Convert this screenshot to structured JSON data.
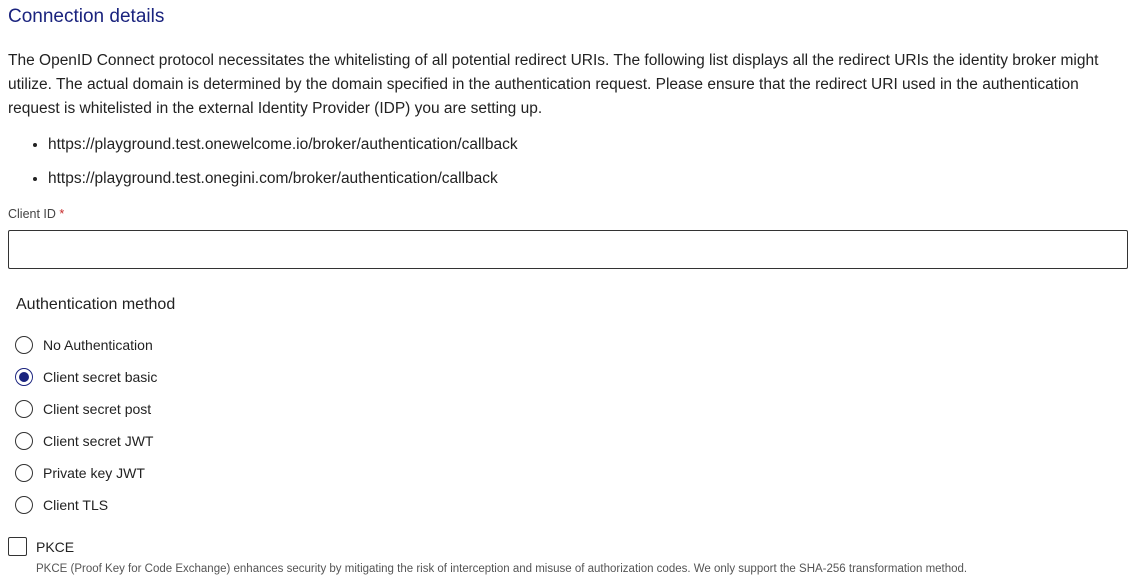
{
  "section": {
    "title": "Connection details",
    "description": "The OpenID Connect protocol necessitates the whitelisting of all potential redirect URIs. The following list displays all the redirect URIs the identity broker might utilize. The actual domain is determined by the domain specified in the authentication request. Please ensure that the redirect URI used in the authentication request is whitelisted in the external Identity Provider (IDP) you are setting up."
  },
  "redirect_uris": [
    "https://playground.test.onewelcome.io/broker/authentication/callback",
    "https://playground.test.onegini.com/broker/authentication/callback"
  ],
  "client_id": {
    "label": "Client ID",
    "required_marker": "*",
    "value": ""
  },
  "auth_method": {
    "label": "Authentication method",
    "selected": "Client secret basic",
    "options": [
      "No Authentication",
      "Client secret basic",
      "Client secret post",
      "Client secret JWT",
      "Private key JWT",
      "Client TLS"
    ]
  },
  "pkce": {
    "label": "PKCE",
    "checked": false,
    "help": "PKCE (Proof Key for Code Exchange) enhances security by mitigating the risk of interception and misuse of authorization codes. We only support the SHA-256 transformation method."
  },
  "colors": {
    "accent": "#1a237e",
    "required": "#c62828"
  }
}
